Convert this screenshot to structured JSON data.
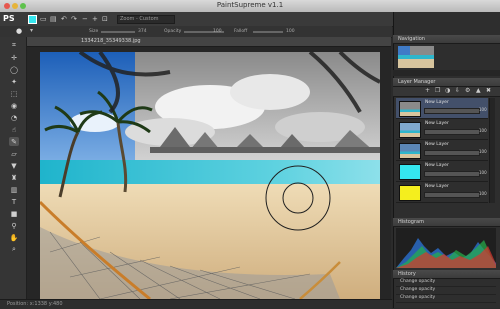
{
  "app": {
    "title": "PaintSupreme v1.1",
    "logo": "PS"
  },
  "toolbar": {
    "mode_label": "Zoom - Custom"
  },
  "options": {
    "size_label": "Size",
    "size_value": "374",
    "opacity_label": "Opacity",
    "opacity_value": "100",
    "falloff_label": "Falloff",
    "falloff_value": "100"
  },
  "document": {
    "tab_label": "1334218_35349338.jpg",
    "status_text": "Position: x:1338 y:480"
  },
  "panels": {
    "navigation_title": "Navigation",
    "layer_manager_title": "Layer Manager",
    "histogram_title": "Histogram",
    "history_title": "History"
  },
  "layers": [
    {
      "name": "New Layer",
      "value": "100",
      "color": "#6a8fb8"
    },
    {
      "name": "New Layer",
      "value": "100",
      "color": "#7fa7cc"
    },
    {
      "name": "New Layer",
      "value": "100",
      "color": "#5b86b5"
    },
    {
      "name": "New Layer",
      "value": "100",
      "color": "#35e6ef"
    },
    {
      "name": "New Layer",
      "value": "100",
      "color": "#f4ee1e"
    }
  ],
  "history": [
    "Change opacity",
    "Change opacity",
    "Change opacity"
  ],
  "colors": {
    "accent": "#43506a",
    "foreground": "#35e6ef",
    "background_swatch": "#ffffff"
  },
  "icons": [
    "crop-icon",
    "move-icon",
    "lasso-icon",
    "magic-wand-icon",
    "brush-icon",
    "eraser-icon",
    "fill-icon",
    "gradient-icon",
    "text-icon",
    "shape-icon",
    "eyedropper-icon",
    "hand-icon",
    "zoom-icon"
  ]
}
